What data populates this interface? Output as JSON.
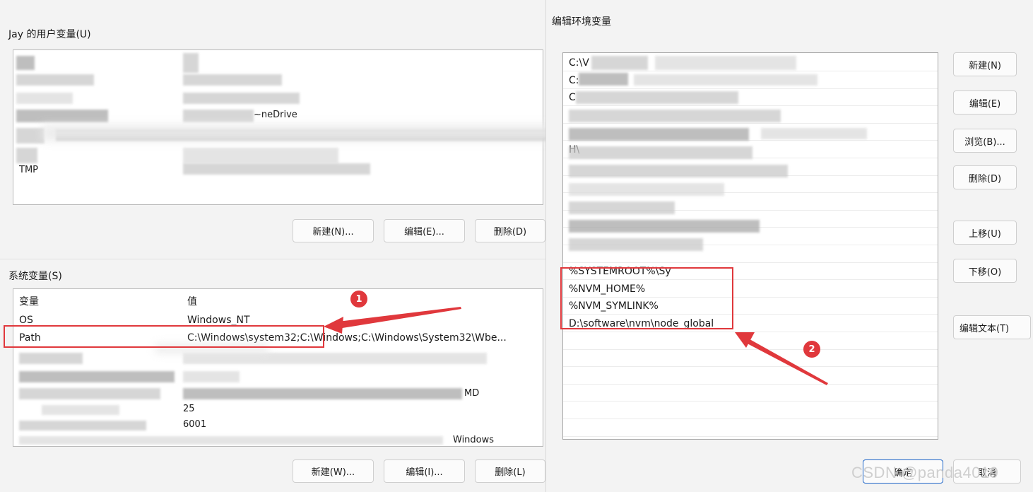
{
  "left_window": {
    "user_vars_label": "Jay 的用户变量(U)",
    "user_partial_texts": [
      "~neDrive",
      "TMP"
    ],
    "user_buttons": {
      "new": "新建(N)...",
      "edit": "编辑(E)...",
      "delete": "删除(D)"
    },
    "system_vars_label": "系统变量(S)",
    "system_header": {
      "variable": "变量",
      "value": "值"
    },
    "system_rows": [
      {
        "name": "OS",
        "value": "Windows_NT"
      },
      {
        "name": "Path",
        "value": "C:\\Windows\\system32;C:\\Windows;C:\\Windows\\System32\\Wbe..."
      }
    ],
    "system_partial_texts": [
      "MD",
      "25",
      "6001",
      "Windows"
    ],
    "system_buttons": {
      "new": "新建(W)...",
      "edit": "编辑(I)...",
      "delete": "删除(L)"
    }
  },
  "right_window": {
    "title": "编辑环境变量",
    "path_entries": [
      "C:\\V",
      "C:",
      "C",
      "",
      "",
      "H\\",
      "",
      "",
      "",
      "",
      "",
      "",
      "%SYSTEMROOT%\\Sy",
      "%NVM_HOME%",
      "%NVM_SYMLINK%",
      "D:\\software\\nvm\\node_global",
      "",
      "",
      "",
      "",
      "",
      "",
      "",
      ""
    ],
    "buttons": {
      "new": "新建(N)",
      "edit": "编辑(E)",
      "browse": "浏览(B)...",
      "delete": "删除(D)",
      "move_up": "上移(U)",
      "move_down": "下移(O)",
      "edit_text": "编辑文本(T)",
      "ok": "确定",
      "cancel": "取消"
    }
  },
  "annotations": {
    "badge1": "1",
    "badge2": "2",
    "color": "#e0383c"
  },
  "watermark": "CSDN @panda4019"
}
